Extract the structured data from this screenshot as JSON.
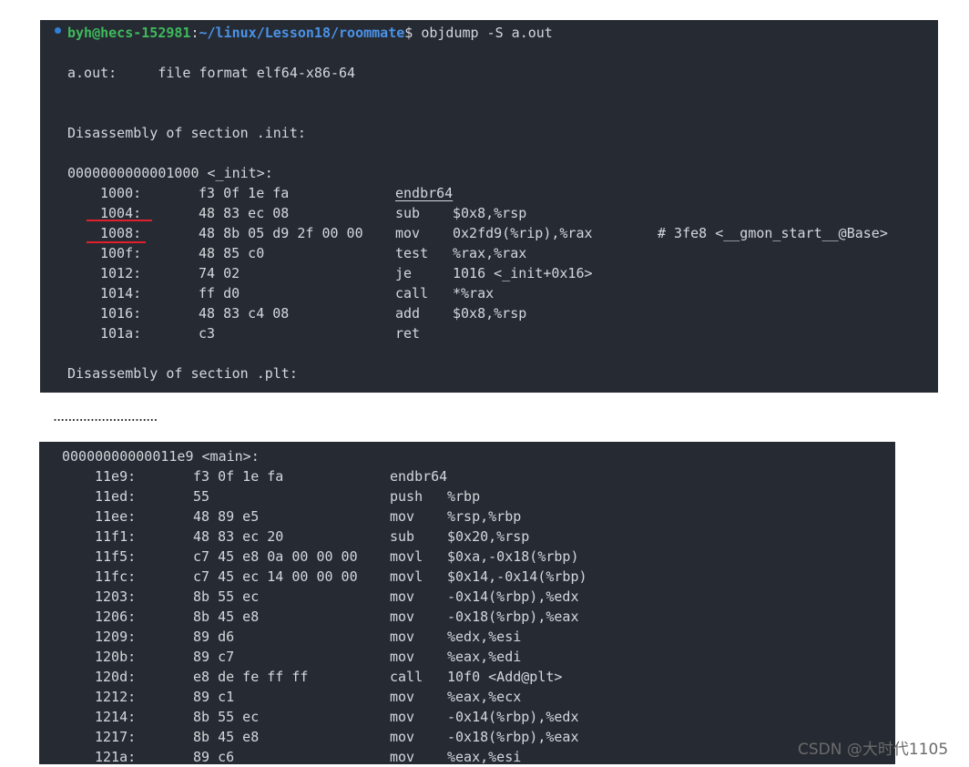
{
  "terminal1": {
    "prompt": {
      "user": "byh@hecs-152981",
      "colon": ":",
      "path": "~/linux/Lesson18/roommate",
      "dollar": "$ ",
      "command": "objdump -S a.out"
    },
    "file_format_line": "a.out:     file format elf64-x86-64",
    "section_init_header": "Disassembly of section .init:",
    "symbol_init": "0000000000001000 <_init>:",
    "rows": [
      {
        "addr": "1000:",
        "bytes": "f3 0f 1e fa",
        "mnem": "endbr64",
        "ops": "",
        "comment": ""
      },
      {
        "addr": "1004:",
        "bytes": "48 83 ec 08",
        "mnem": "sub",
        "ops": "$0x8,%rsp",
        "comment": ""
      },
      {
        "addr": "1008:",
        "bytes": "48 8b 05 d9 2f 00 00",
        "mnem": "mov",
        "ops": "0x2fd9(%rip),%rax",
        "comment": "# 3fe8 <__gmon_start__@Base>"
      },
      {
        "addr": "100f:",
        "bytes": "48 85 c0",
        "mnem": "test",
        "ops": "%rax,%rax",
        "comment": ""
      },
      {
        "addr": "1012:",
        "bytes": "74 02",
        "mnem": "je",
        "ops": "1016 <_init+0x16>",
        "comment": ""
      },
      {
        "addr": "1014:",
        "bytes": "ff d0",
        "mnem": "call",
        "ops": "*%rax",
        "comment": ""
      },
      {
        "addr": "1016:",
        "bytes": "48 83 c4 08",
        "mnem": "add",
        "ops": "$0x8,%rsp",
        "comment": ""
      },
      {
        "addr": "101a:",
        "bytes": "c3",
        "mnem": "ret",
        "ops": "",
        "comment": ""
      }
    ],
    "section_plt_header": "Disassembly of section .plt:"
  },
  "ellipsis": "............................",
  "terminal2": {
    "symbol_main": "00000000000011e9 <main>:",
    "rows": [
      {
        "addr": "11e9:",
        "bytes": "f3 0f 1e fa",
        "mnem": "endbr64",
        "ops": ""
      },
      {
        "addr": "11ed:",
        "bytes": "55",
        "mnem": "push",
        "ops": "%rbp"
      },
      {
        "addr": "11ee:",
        "bytes": "48 89 e5",
        "mnem": "mov",
        "ops": "%rsp,%rbp"
      },
      {
        "addr": "11f1:",
        "bytes": "48 83 ec 20",
        "mnem": "sub",
        "ops": "$0x20,%rsp"
      },
      {
        "addr": "11f5:",
        "bytes": "c7 45 e8 0a 00 00 00",
        "mnem": "movl",
        "ops": "$0xa,-0x18(%rbp)"
      },
      {
        "addr": "11fc:",
        "bytes": "c7 45 ec 14 00 00 00",
        "mnem": "movl",
        "ops": "$0x14,-0x14(%rbp)"
      },
      {
        "addr": "1203:",
        "bytes": "8b 55 ec",
        "mnem": "mov",
        "ops": "-0x14(%rbp),%edx"
      },
      {
        "addr": "1206:",
        "bytes": "8b 45 e8",
        "mnem": "mov",
        "ops": "-0x18(%rbp),%eax"
      },
      {
        "addr": "1209:",
        "bytes": "89 d6",
        "mnem": "mov",
        "ops": "%edx,%esi"
      },
      {
        "addr": "120b:",
        "bytes": "89 c7",
        "mnem": "mov",
        "ops": "%eax,%edi"
      },
      {
        "addr": "120d:",
        "bytes": "e8 de fe ff ff",
        "mnem": "call",
        "ops": "10f0 <Add@plt>"
      },
      {
        "addr": "1212:",
        "bytes": "89 c1",
        "mnem": "mov",
        "ops": "%eax,%ecx"
      },
      {
        "addr": "1214:",
        "bytes": "8b 55 ec",
        "mnem": "mov",
        "ops": "-0x14(%rbp),%edx"
      },
      {
        "addr": "1217:",
        "bytes": "8b 45 e8",
        "mnem": "mov",
        "ops": "-0x18(%rbp),%eax"
      },
      {
        "addr": "121a:",
        "bytes": "89 c6",
        "mnem": "mov",
        "ops": "%eax,%esi"
      }
    ]
  },
  "watermark": "CSDN @大时代1105",
  "colors": {
    "terminal_bg": "#262b33",
    "text": "#d4d7dc",
    "prompt_user": "#3fb95c",
    "prompt_path": "#4a92e8",
    "status_dot": "#2f80d6",
    "annotation_red": "#e0202a"
  },
  "icons": {
    "prompt_status": "status-dot-icon"
  }
}
